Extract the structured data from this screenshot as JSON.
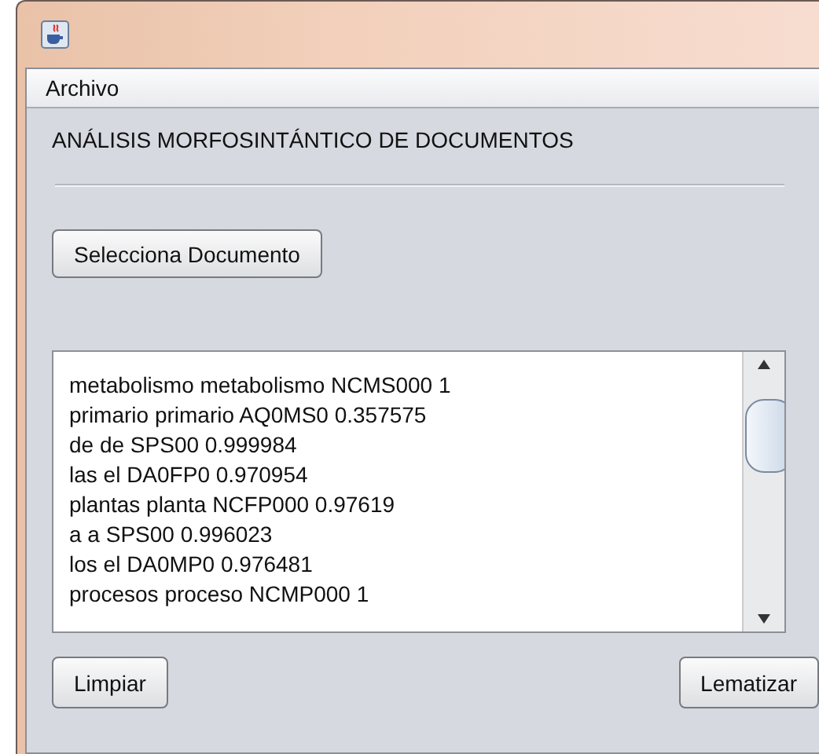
{
  "menu_bar": {
    "items": [
      "Archivo"
    ]
  },
  "heading": "ANÁLISIS MORFOSINTÁNTICO DE DOCUMENTOS",
  "select_button": "Selecciona Documento",
  "output_lines": [
    "metabolismo metabolismo NCMS000 1",
    "primario primario AQ0MS0 0.357575",
    "de de SPS00 0.999984",
    "las el DA0FP0 0.970954",
    "plantas planta NCFP000 0.97619",
    "a a SPS00 0.996023",
    "los el DA0MP0 0.976481",
    "procesos proceso NCMP000 1"
  ],
  "buttons": [
    "Limpiar",
    "Lematizar"
  ]
}
